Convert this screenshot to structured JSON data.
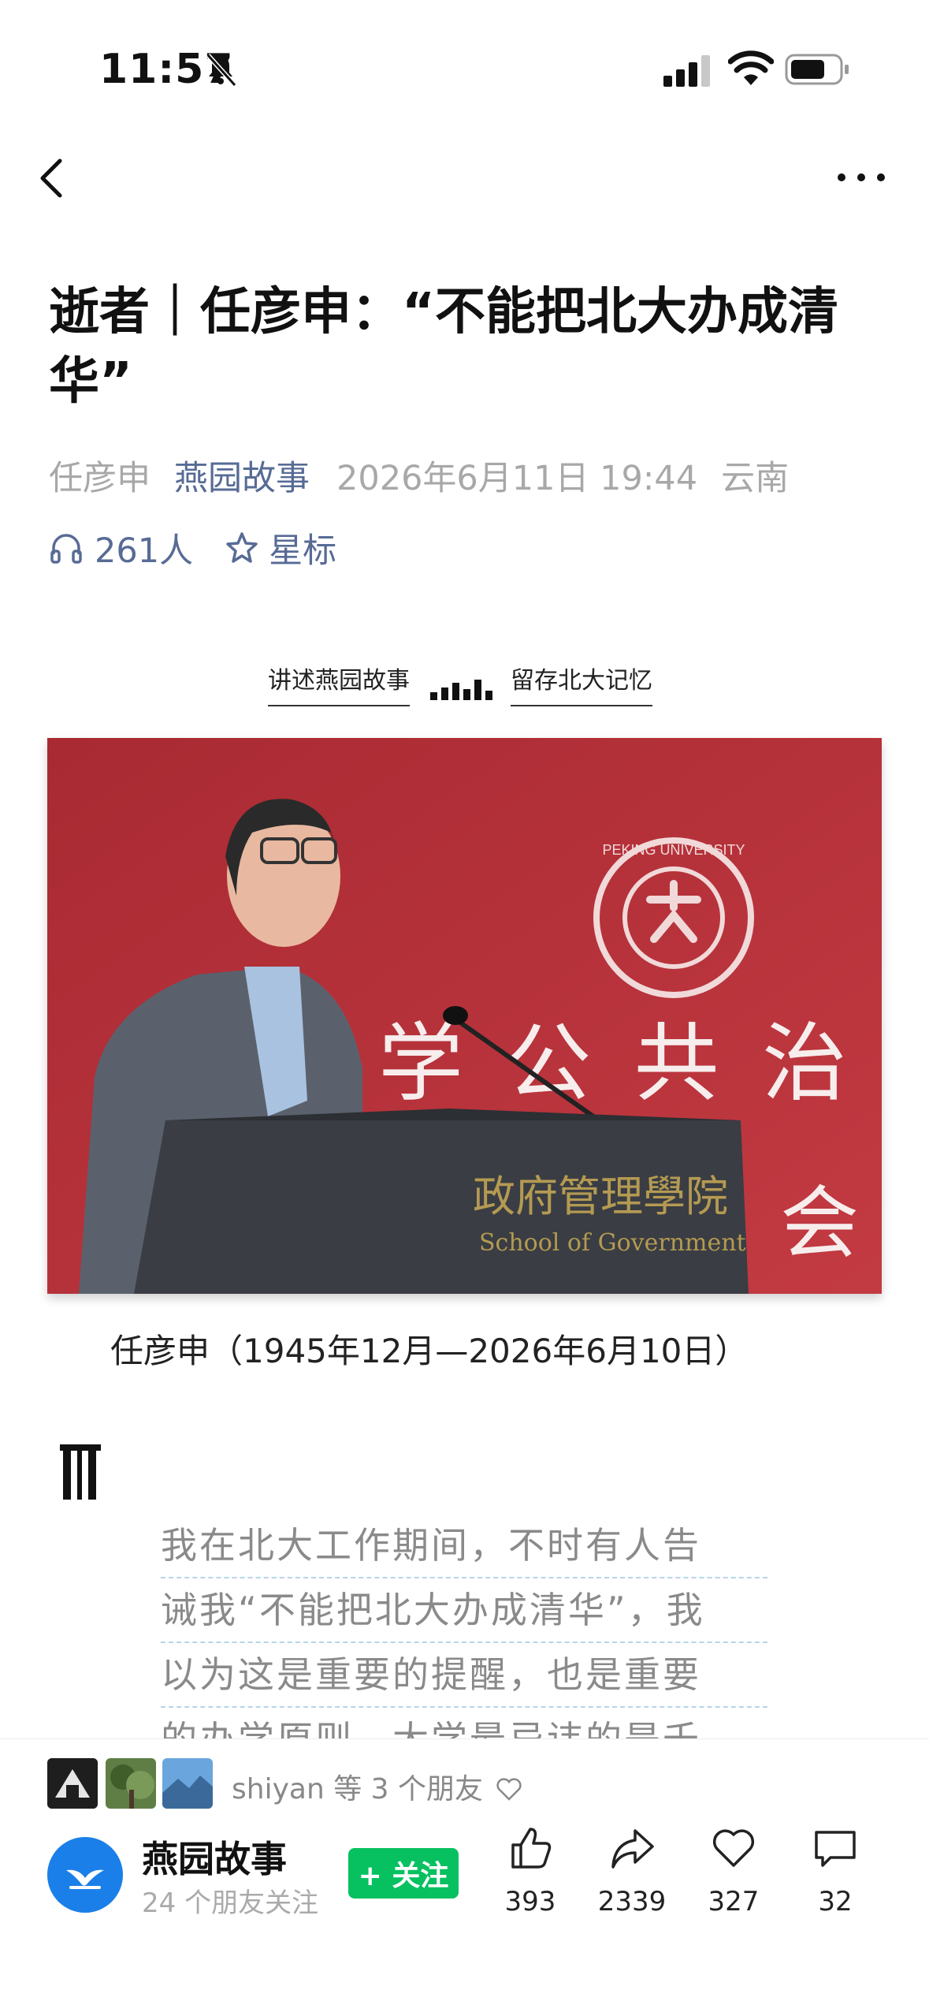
{
  "status_bar": {
    "time": "11:57"
  },
  "article": {
    "title": "逝者｜任彦申：“不能把北大办成清华”",
    "author": "任彦申",
    "account": "燕园故事",
    "datetime": "2026年6月11日 19:44",
    "location": "云南",
    "listeners": "261人",
    "star_label": "星标",
    "banner_left": "讲述燕园故事",
    "banner_right": "留存北大记忆",
    "caption": "任彦申（1945年12月—2026年6月10日）",
    "quote_lines": [
      "我在北大工作期间，不时有人告",
      "诫我“不能把北大办成清华”，我",
      "以为这是重要的提醒，也是重要",
      "的办学原则，大学最忌讳的是千"
    ]
  },
  "photo": {
    "backdrop_text": "学 公 共 治 理",
    "backdrop_text2": "会",
    "podium_text": "政府管理學院",
    "podium_text_en": "School of Government",
    "emblem_text": "PEKING UNIVERSITY"
  },
  "footer": {
    "friends_text": "shiyan 等 3 个朋友",
    "account_name": "燕园故事",
    "account_sub": "24 个朋友关注",
    "follow_label": "+ 关注",
    "like_count": "393",
    "share_count": "2339",
    "fav_count": "327",
    "comment_count": "32"
  },
  "colors": {
    "accent": "#576b95",
    "follow": "#07c160",
    "backdrop": "#b22e36"
  }
}
